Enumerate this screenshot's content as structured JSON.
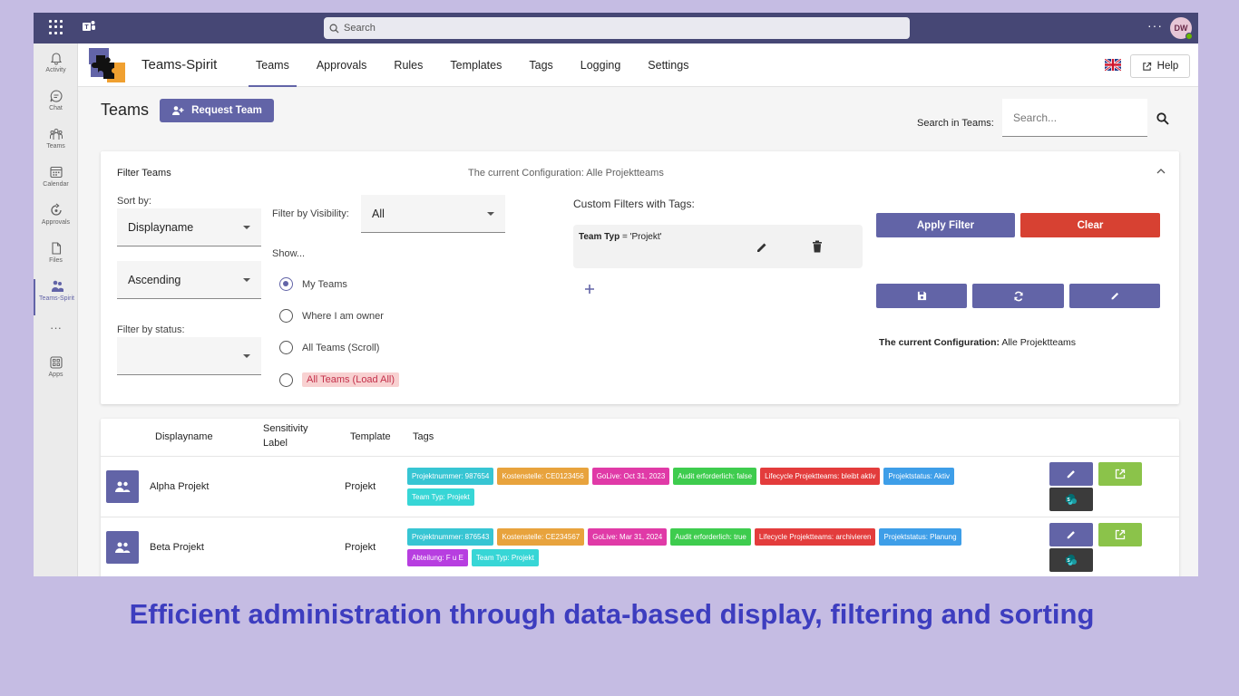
{
  "topbar": {
    "search_placeholder": "Search",
    "more_label": "···",
    "user_initials": "DW"
  },
  "rail": {
    "items": [
      {
        "label": "Activity",
        "icon": "bell-icon"
      },
      {
        "label": "Chat",
        "icon": "chat-icon"
      },
      {
        "label": "Teams",
        "icon": "teams-icon"
      },
      {
        "label": "Calendar",
        "icon": "calendar-icon"
      },
      {
        "label": "Approvals",
        "icon": "approvals-icon"
      },
      {
        "label": "Files",
        "icon": "file-icon"
      },
      {
        "label": "Teams-Spirit",
        "icon": "teams-spirit-icon"
      },
      {
        "label": "···",
        "icon": "more-icon"
      },
      {
        "label": "Apps",
        "icon": "apps-icon"
      }
    ]
  },
  "app": {
    "name": "Teams-Spirit",
    "tabs": [
      "Teams",
      "Approvals",
      "Rules",
      "Templates",
      "Tags",
      "Logging",
      "Settings"
    ],
    "active_tab": "Teams",
    "help_label": "Help"
  },
  "header": {
    "title": "Teams",
    "request_button": "Request Team",
    "search_label": "Search in Teams:",
    "search_placeholder": "Search..."
  },
  "filter": {
    "title": "Filter Teams",
    "current_config_top": "The current Configuration: Alle Projektteams",
    "sort_by_label": "Sort by:",
    "sort_field": "Displayname",
    "sort_order": "Ascending",
    "status_label": "Filter by status:",
    "visibility_label": "Filter by Visibility:",
    "visibility_value": "All",
    "show_label": "Show...",
    "show_options": [
      "My Teams",
      "Where I am owner",
      "All Teams (Scroll)",
      "All Teams (Load All)"
    ],
    "show_selected": "My Teams",
    "custom_label": "Custom Filters with Tags:",
    "custom_key": "Team Typ",
    "custom_op": "= 'Projekt'",
    "apply_label": "Apply Filter",
    "clear_label": "Clear",
    "current_label_bold": "The current Configuration:",
    "current_value": "Alle Projektteams"
  },
  "table": {
    "headers": {
      "displayname": "Displayname",
      "sensitivity_1": "Sensitivity",
      "sensitivity_2": "Label",
      "template": "Template",
      "tags": "Tags"
    },
    "rows": [
      {
        "name": "Alpha Projekt",
        "template": "Projekt",
        "tags": [
          {
            "text": "Projektnummer: 987654",
            "color": "#37c5d3"
          },
          {
            "text": "Kostenstelle: CE0123456",
            "color": "#e8a33d"
          },
          {
            "text": "GoLive: Oct 31, 2023",
            "color": "#e03aa7"
          },
          {
            "text": "Audit erforderlich: false",
            "color": "#3ecc4e"
          },
          {
            "text": "Lifecycle Projektteams: bleibt aktiv",
            "color": "#e33c3c"
          },
          {
            "text": "Projektstatus: Aktiv",
            "color": "#3e9ee8"
          },
          {
            "text": "Team Typ: Projekt",
            "color": "#37d6d6"
          }
        ]
      },
      {
        "name": "Beta Projekt",
        "template": "Projekt",
        "tags": [
          {
            "text": "Projektnummer: 876543",
            "color": "#37c5d3"
          },
          {
            "text": "Kostenstelle: CE234567",
            "color": "#e8a33d"
          },
          {
            "text": "GoLive: Mar 31, 2024",
            "color": "#e03aa7"
          },
          {
            "text": "Audit erforderlich: true",
            "color": "#3ecc4e"
          },
          {
            "text": "Lifecycle Projektteams: archivieren",
            "color": "#e33c3c"
          },
          {
            "text": "Projektstatus: Planung",
            "color": "#3e9ee8"
          },
          {
            "text": "Abteilung: F u E",
            "color": "#b73ee0"
          },
          {
            "text": "Team Typ: Projekt",
            "color": "#37d6d6"
          }
        ]
      }
    ]
  },
  "caption": "Efficient administration through data-based display, filtering and sorting",
  "colors": {
    "accent": "#6264a7",
    "clear": "#d74132",
    "open": "#8bc34a",
    "sharepoint": "#3b3b3b"
  }
}
